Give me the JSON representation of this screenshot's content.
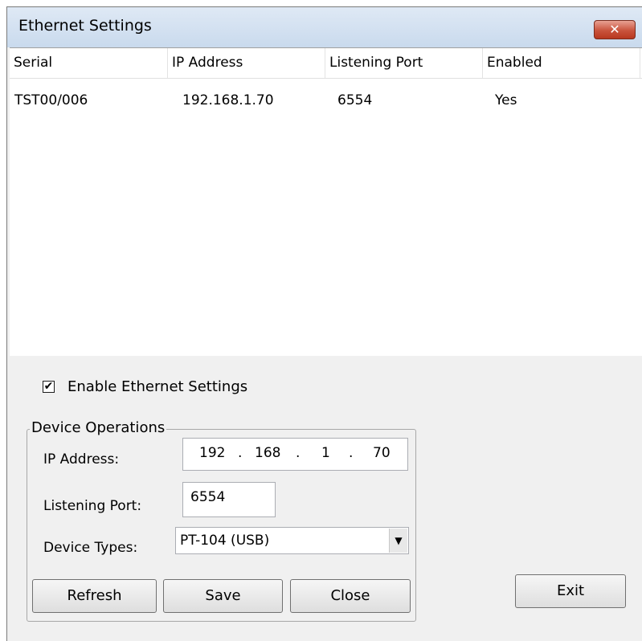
{
  "window": {
    "title": "Ethernet Settings",
    "close_label": "✕"
  },
  "table": {
    "columns": [
      "Serial",
      "IP Address",
      "Listening Port",
      "Enabled"
    ],
    "rows": [
      {
        "serial": "TST00/006",
        "ip": "192.168.1.70",
        "port": "6554",
        "enabled": "Yes"
      }
    ]
  },
  "enable_checkbox": {
    "label": "Enable Ethernet Settings",
    "checked": true,
    "mark": "✔"
  },
  "device_operations": {
    "title": "Device Operations",
    "ip_label": "IP Address:",
    "ip_parts": [
      "192",
      ".",
      "168",
      ".",
      "1",
      ".",
      "70"
    ],
    "port_label": "Listening Port:",
    "port_value": "6554",
    "type_label": "Device Types:",
    "type_value": "PT-104 (USB)",
    "arrow": "▼"
  },
  "buttons": {
    "refresh": "Refresh",
    "save": "Save",
    "close": "Close",
    "exit": "Exit"
  }
}
